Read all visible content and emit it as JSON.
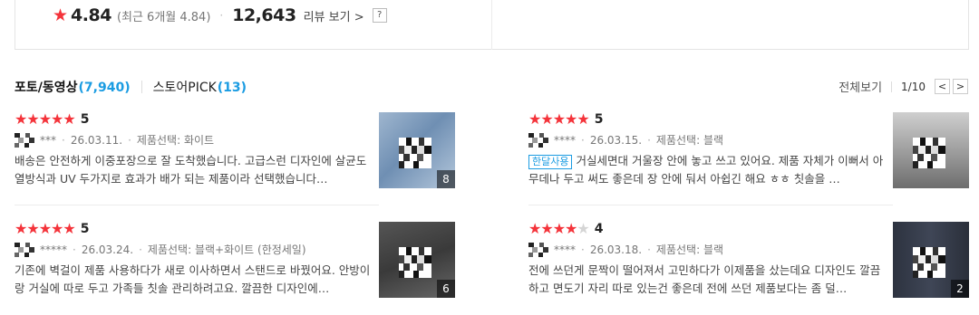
{
  "summary": {
    "score": "4.84",
    "recent": "(최근 6개월 4.84)",
    "review_count": "12,643",
    "review_link": "리뷰 보기",
    "help": "?"
  },
  "tabs": [
    {
      "label": "포토/동영상",
      "count": "(7,940)"
    },
    {
      "label": "스토어PICK",
      "count": "(13)"
    }
  ],
  "pager": {
    "view_all": "전체보기",
    "page": "1/10",
    "prev": "<",
    "next": ">"
  },
  "reviews": [
    {
      "rating": "5",
      "stars": 5,
      "user": "***",
      "date": "26.03.11.",
      "option": "제품선택: 화이트",
      "badge": "",
      "text": "배송은 안전하게 이중포장으로 잘 도착했습니다. 고급스런 디자인에 살균도 열방식과 UV 두가지로 효과가 배가 되는 제품이라 선택했습니다…",
      "photo_count": "8"
    },
    {
      "rating": "5",
      "stars": 5,
      "user": "****",
      "date": "26.03.15.",
      "option": "제품선택: 블랙",
      "badge": "한달사용",
      "text": "거실세면대 거울장 안에 놓고 쓰고 있어요. 제품 자체가 이뻐서 아무데나 두고 써도 좋은데 장 안에 둬서 아쉽긴 해요 ㅎㅎ 칫솔을 …",
      "photo_count": ""
    },
    {
      "rating": "5",
      "stars": 5,
      "user": "*****",
      "date": "26.03.24.",
      "option": "제품선택: 블랙+화이트 (한정세일)",
      "badge": "",
      "text": "기존에 벽걸이 제품 사용하다가 새로 이사하면서 스탠드로 바꿨어요. 안방이랑 거실에 따로 두고 가족들 칫솔 관리하려고요. 깔끔한 디자인에…",
      "photo_count": "6"
    },
    {
      "rating": "4",
      "stars": 4,
      "user": "****",
      "date": "26.03.18.",
      "option": "제품선택: 블랙",
      "badge": "",
      "text": "전에 쓰던게 문짝이 떨어져서 고민하다가 이제품을 샀는데요 디자인도 깔끔하고 면도기 자리 따로 있는건 좋은데 전에 쓰던 제품보다는 좀 덜…",
      "photo_count": "2"
    }
  ],
  "colors": {
    "star": "#f4333a",
    "accent": "#1b9ce2"
  }
}
